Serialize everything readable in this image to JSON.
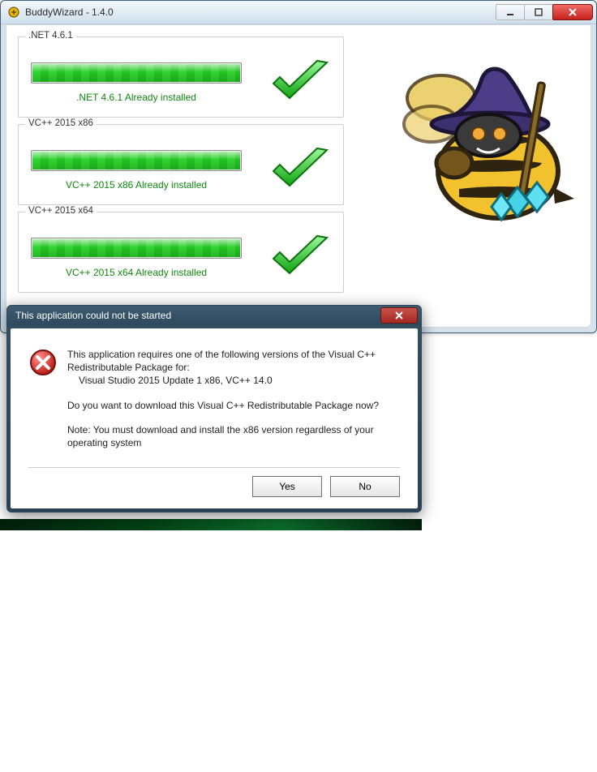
{
  "mainWindow": {
    "title": "BuddyWizard - 1.4.0",
    "iconName": "app-icon",
    "groups": [
      {
        "title": ".NET 4.6.1",
        "status": ".NET 4.6.1 Already installed"
      },
      {
        "title": "VC++ 2015 x86",
        "status": "VC++ 2015 x86 Already installed"
      },
      {
        "title": "VC++ 2015 x64",
        "status": "VC++ 2015 x64 Already installed"
      }
    ]
  },
  "dialog": {
    "title": "This application could not be started",
    "msg1a": "This application requires one of the following versions of the Visual C++ Redistributable Package for:",
    "msg1b": "Visual Studio 2015 Update 1 x86, VC++ 14.0",
    "msg2": "Do you want to download this Visual C++ Redistributable Package now?",
    "msg3": "Note: You must download and install the x86 version regardless of your operating system",
    "buttons": {
      "yes": "Yes",
      "no": "No"
    }
  }
}
